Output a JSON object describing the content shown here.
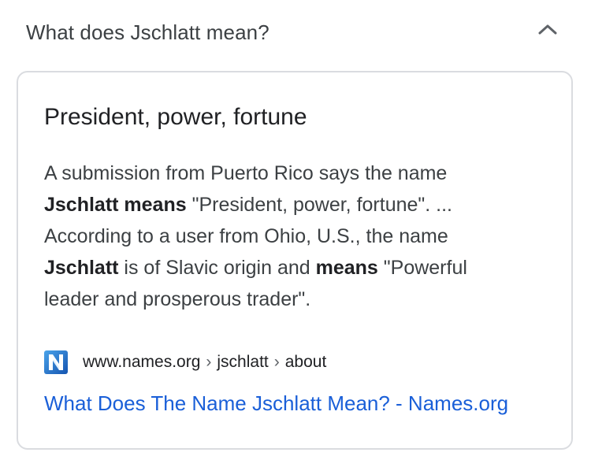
{
  "question": {
    "text": "What does Jschlatt mean?",
    "toggle_icon": "chevron-up-icon"
  },
  "answer": {
    "title": "President, power, fortune",
    "snippet_lines": [
      [
        {
          "t": "A submission from Puerto Rico says the name",
          "b": false
        }
      ],
      [
        {
          "t": "Jschlatt means",
          "b": true
        },
        {
          "t": " \"President, power, fortune\". ...",
          "b": false
        }
      ],
      [
        {
          "t": "According to a user from Ohio, U.S., the name",
          "b": false
        }
      ],
      [
        {
          "t": "Jschlatt",
          "b": true
        },
        {
          "t": " is of Slavic origin and ",
          "b": false
        },
        {
          "t": "means",
          "b": true
        },
        {
          "t": " \"Powerful",
          "b": false
        }
      ],
      [
        {
          "t": "leader and prosperous trader\".",
          "b": false
        }
      ]
    ]
  },
  "source": {
    "favicon_icon": "names-org-favicon-icon",
    "favicon_letter": "N",
    "domain": "www.names.org",
    "separator": "›",
    "path": [
      "jschlatt",
      "about"
    ]
  },
  "link": {
    "text": "What Does The Name Jschlatt Mean? - Names.org"
  },
  "colors": {
    "link": "#1a5fd8",
    "card_border": "#dadce0",
    "favicon_blue": "#1f6fc5",
    "text": "#202124"
  }
}
